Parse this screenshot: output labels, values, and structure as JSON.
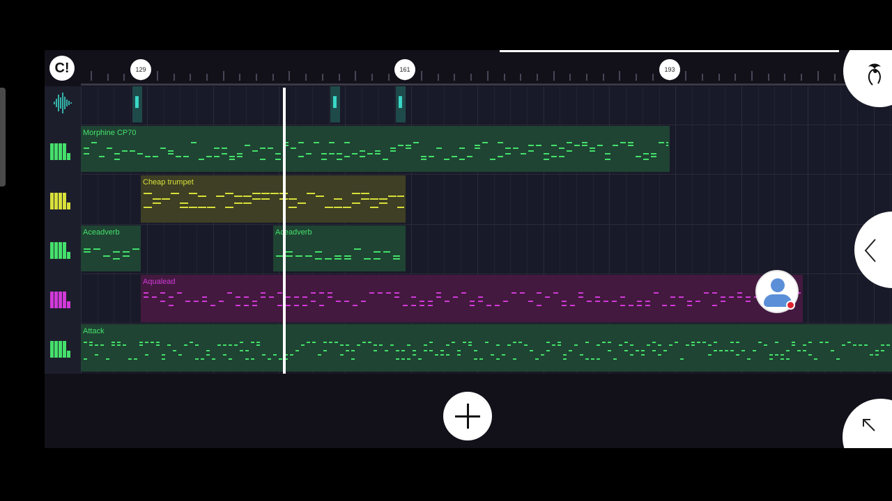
{
  "ruler": {
    "magnet_icon": "magnet-icon",
    "magnet_glyph": "C!",
    "markers": [
      "129",
      "161",
      "193"
    ]
  },
  "tracks": [
    {
      "type": "audio",
      "icon": "waveform-icon",
      "color": "#3ad8c8"
    },
    {
      "type": "instrument",
      "icon": "piano-keys-icon",
      "color": "#45e06b"
    },
    {
      "type": "instrument",
      "icon": "piano-keys-icon",
      "color": "#d8e03a"
    },
    {
      "type": "instrument",
      "icon": "piano-keys-icon",
      "color": "#45e06b"
    },
    {
      "type": "instrument",
      "icon": "piano-keys-icon",
      "color": "#d13ad8"
    },
    {
      "type": "instrument",
      "icon": "piano-keys-icon",
      "color": "#45e06b"
    }
  ],
  "clips": {
    "morphine": {
      "label": "Morphine CP70",
      "fill": "#1f4433",
      "note_color": "#45e06b"
    },
    "trumpet": {
      "label": "Cheap trumpet",
      "fill": "#3e3f24",
      "note_color": "#d8e03a"
    },
    "acead_1": {
      "label": "Aceadverb",
      "fill": "#1f4433",
      "note_color": "#45e06b"
    },
    "acead_2": {
      "label": "Aceadverb",
      "fill": "#1f4433",
      "note_color": "#45e06b"
    },
    "aqua": {
      "label": "Aqualead",
      "fill": "#43193f",
      "note_color": "#d13ad8"
    },
    "attack": {
      "label": "Attack",
      "fill": "#1f4433",
      "note_color": "#45e06b"
    }
  },
  "buttons": {
    "add_icon": "plus-icon",
    "logo_icon": "fruit-logo-icon",
    "side_panel_icon": "chevron-left-icon",
    "expand_icon": "arrow-up-left-icon",
    "avatar_icon": "user-avatar-icon"
  }
}
